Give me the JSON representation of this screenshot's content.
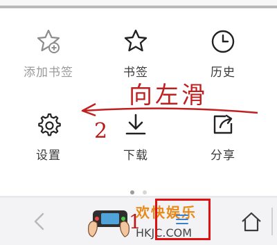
{
  "menu": {
    "items": [
      {
        "label": "添加书签",
        "icon": "add-bookmark-icon",
        "disabled": true
      },
      {
        "label": "书签",
        "icon": "star-icon",
        "disabled": false
      },
      {
        "label": "历史",
        "icon": "clock-icon",
        "disabled": false
      },
      {
        "label": "设置",
        "icon": "gear-icon",
        "disabled": false
      },
      {
        "label": "下载",
        "icon": "download-icon",
        "disabled": false
      },
      {
        "label": "分享",
        "icon": "share-icon",
        "disabled": false
      }
    ]
  },
  "annotation": {
    "swipe_text": "向左滑",
    "step1": "1",
    "step2": "2",
    "color": "#c01f1f"
  },
  "watermark": {
    "line1": "欢快娱乐",
    "line2": "HKJC.COM"
  },
  "pagination": {
    "pages": 2,
    "current": 0
  },
  "toolbar": {
    "back_icon": "chevron-left-icon",
    "home_icon": "home-icon"
  }
}
